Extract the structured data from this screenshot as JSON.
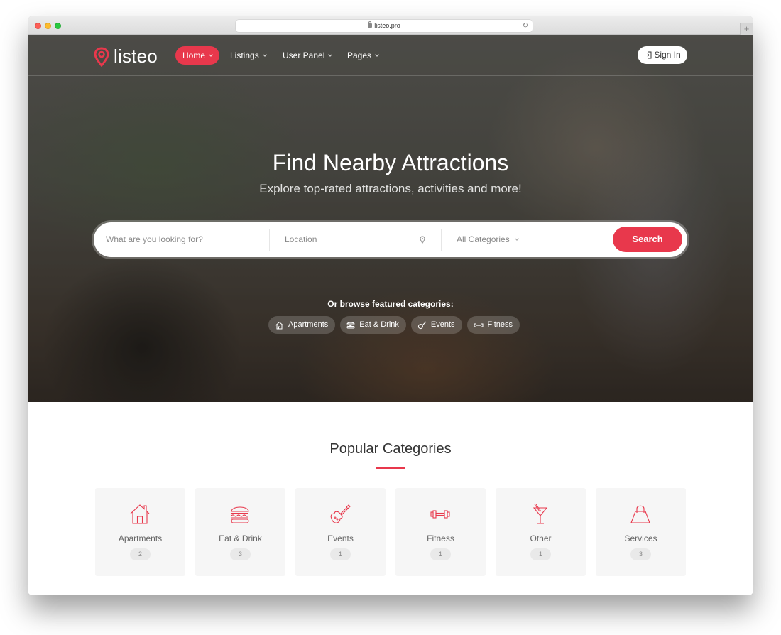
{
  "browser": {
    "url": "listeo.pro",
    "new_tab_label": "+"
  },
  "nav": {
    "logo_text": "listeo",
    "items": [
      {
        "label": "Home",
        "active": true
      },
      {
        "label": "Listings",
        "active": false
      },
      {
        "label": "User Panel",
        "active": false
      },
      {
        "label": "Pages",
        "active": false
      }
    ],
    "sign_in": "Sign In"
  },
  "hero": {
    "title": "Find Nearby Attractions",
    "subtitle": "Explore top-rated attractions, activities and more!",
    "search": {
      "what_placeholder": "What are you looking for?",
      "location_placeholder": "Location",
      "category_selected": "All Categories",
      "button": "Search"
    },
    "browse_label": "Or browse featured categories:",
    "featured": [
      {
        "label": "Apartments",
        "icon": "house-icon"
      },
      {
        "label": "Eat & Drink",
        "icon": "burger-icon"
      },
      {
        "label": "Events",
        "icon": "guitar-icon"
      },
      {
        "label": "Fitness",
        "icon": "dumbbell-icon"
      }
    ]
  },
  "popular": {
    "title": "Popular Categories",
    "categories": [
      {
        "label": "Apartments",
        "count": "2",
        "icon": "house-icon"
      },
      {
        "label": "Eat & Drink",
        "count": "3",
        "icon": "burger-icon"
      },
      {
        "label": "Events",
        "count": "1",
        "icon": "guitar-icon"
      },
      {
        "label": "Fitness",
        "count": "1",
        "icon": "dumbbell-icon"
      },
      {
        "label": "Other",
        "count": "1",
        "icon": "cocktail-icon"
      },
      {
        "label": "Services",
        "count": "3",
        "icon": "bag-icon"
      }
    ]
  },
  "colors": {
    "accent": "#e8384c",
    "card_bg": "#f6f6f6"
  }
}
